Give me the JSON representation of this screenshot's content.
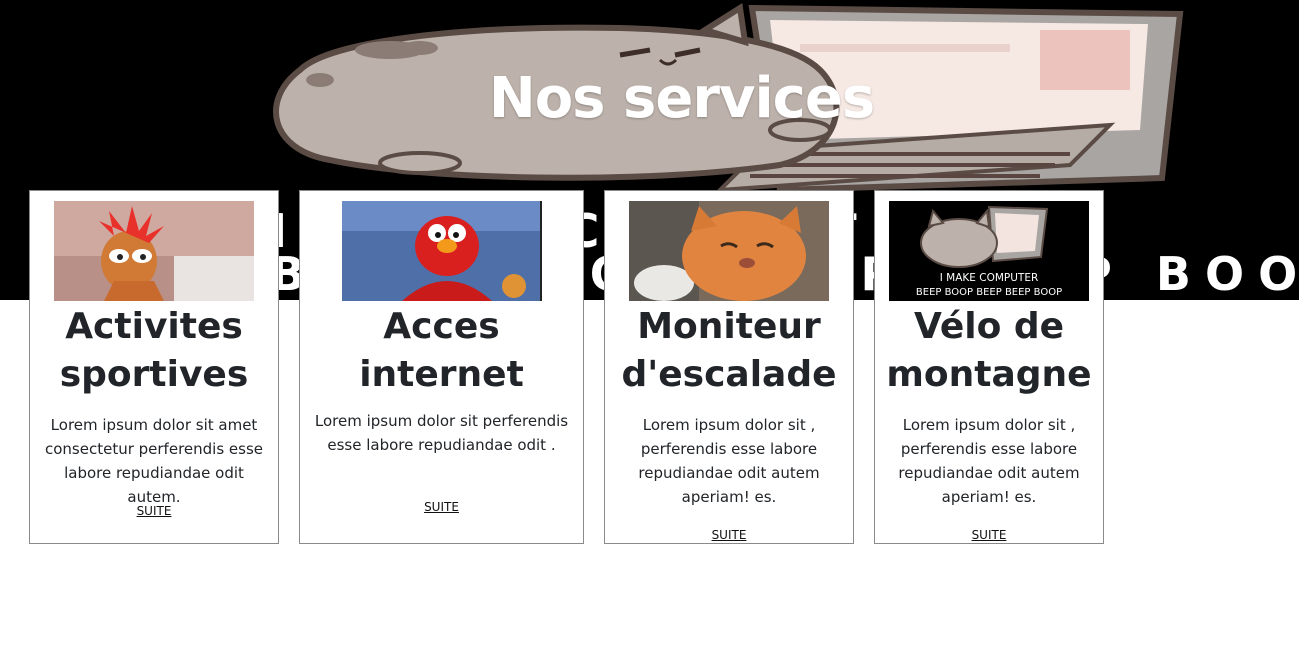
{
  "hero": {
    "title": "Nos services",
    "overlay_lines": [
      "I MAKE COMPUTER",
      "BEEP BOOP BEEP BEEP BOOP"
    ]
  },
  "cards": [
    {
      "title": "Activites sportives",
      "image": "red-haired-puppet-image",
      "text": "Lorem ipsum dolor sit amet consectetur perferendis esse labore repudiandae odit autem.",
      "link": "SUITE"
    },
    {
      "title": "Acces internet",
      "image": "red-furry-puppet-image",
      "text": "Lorem ipsum dolor sit perferendis esse labore repudiandae odit .",
      "link": "SUITE"
    },
    {
      "title": "Moniteur d'escalade",
      "image": "orange-cat-photo",
      "text": "Lorem ipsum dolor sit , perferendis esse labore repudiandae odit autem aperiam! es.",
      "link": "SUITE"
    },
    {
      "title": "Vélo de montagne",
      "image": "cat-laptop-image",
      "image_caption_lines": [
        "I MAKE COMPUTER",
        "BEEP BOOP BEEP BEEP BOOP"
      ],
      "text": "Lorem ipsum dolor sit , perferendis esse labore repudiandae odit autem aperiam! es.",
      "link": "SUITE"
    }
  ],
  "colors": {
    "hero_background": "#000000",
    "card_border": "#8a8a8a",
    "text": "#212529"
  }
}
